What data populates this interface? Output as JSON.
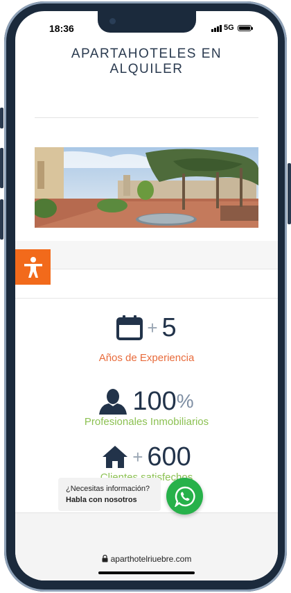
{
  "status_bar": {
    "time": "18:36",
    "network": "5G"
  },
  "header": {
    "title_line1": "APARTAHOTELES EN",
    "title_line2": "ALQUILER"
  },
  "stats": [
    {
      "prefix": "+",
      "value": "5",
      "suffix": "",
      "label": "Años de Experiencia",
      "icon": "calendar-icon",
      "label_color": "#e86a3a"
    },
    {
      "prefix": "",
      "value": "100",
      "suffix": "%",
      "label": "Profesionales Inmobiliarios",
      "icon": "person-icon",
      "label_color": "#8cc152"
    },
    {
      "prefix": "+",
      "value": "600",
      "suffix": "",
      "label": "Clientes satisfechos",
      "icon": "home-icon",
      "label_color": "#8cc152"
    }
  ],
  "chat_widget": {
    "line1": "¿Necesitas información?",
    "line2": "Habla con nosotros",
    "icon": "whatsapp-icon"
  },
  "browser": {
    "url": "aparthotelriuebre.com",
    "icon": "lock-icon"
  },
  "accessibility": {
    "icon": "accessibility-icon"
  },
  "colors": {
    "accent": "#f26a1b",
    "navy": "#22334a",
    "green": "#8cc152",
    "whatsapp": "#27b14a"
  }
}
